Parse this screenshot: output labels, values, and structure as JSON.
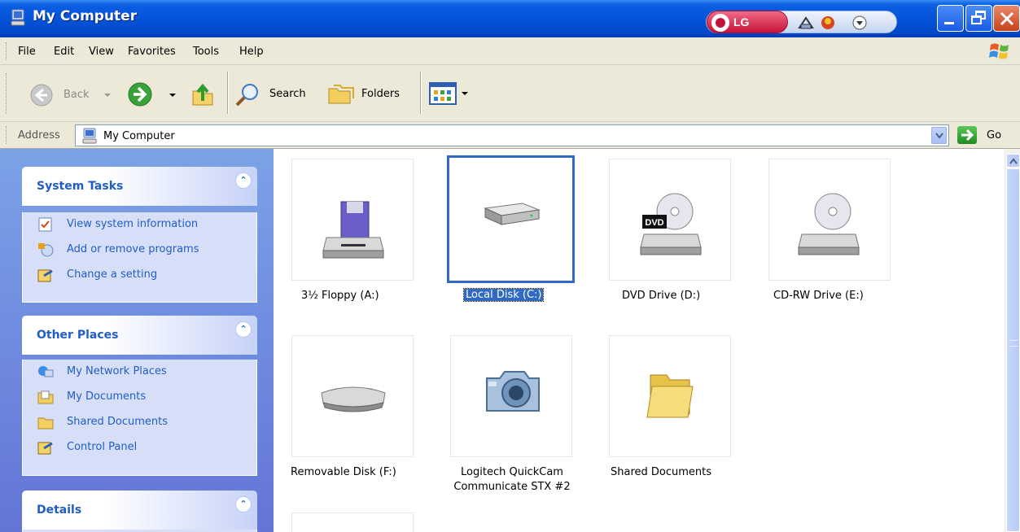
{
  "window": {
    "title": "My Computer",
    "lg_label": "LG"
  },
  "menu": [
    "File",
    "Edit",
    "View",
    "Favorites",
    "Tools",
    "Help"
  ],
  "toolbar": {
    "back_label": "Back",
    "search_label": "Search",
    "folders_label": "Folders"
  },
  "address": {
    "label": "Address",
    "value": "My Computer",
    "go_label": "Go"
  },
  "taskpane": {
    "system_tasks": {
      "title": "System Tasks",
      "items": [
        "View system information",
        "Add or remove programs",
        "Change a setting"
      ]
    },
    "other_places": {
      "title": "Other Places",
      "items": [
        "My Network Places",
        "My Documents",
        "Shared Documents",
        "Control Panel"
      ]
    },
    "details": {
      "title": "Details"
    }
  },
  "items": [
    {
      "label": "3½ Floppy (A:)",
      "icon": "floppy-drive-icon"
    },
    {
      "label": "Local Disk (C:)",
      "icon": "hard-disk-icon",
      "selected": true
    },
    {
      "label": "DVD Drive (D:)",
      "icon": "dvd-drive-icon"
    },
    {
      "label": "CD-RW Drive (E:)",
      "icon": "cd-drive-icon"
    },
    {
      "label": "Removable Disk (F:)",
      "icon": "removable-disk-icon"
    },
    {
      "label_line1": "Logitech QuickCam",
      "label_line2": "Communicate STX #2",
      "icon": "camera-icon"
    },
    {
      "label": "Shared Documents",
      "icon": "folder-icon"
    }
  ],
  "colors": {
    "titlebar": "#0553d8",
    "selection": "#316ac5",
    "taskpane_link": "#215dc6"
  }
}
